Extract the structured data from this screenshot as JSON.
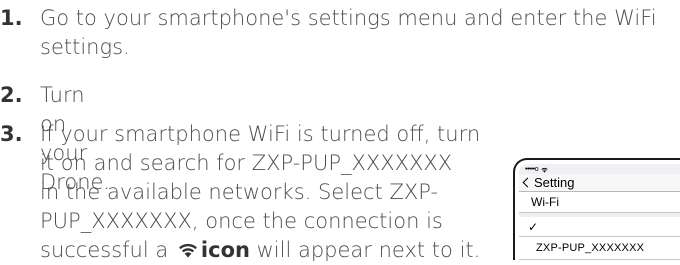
{
  "instructions": {
    "steps": [
      {
        "number": "1.",
        "text": "Go to your smartphone's settings menu and enter the WiFi\nsettings."
      },
      {
        "number": "2.",
        "text": "Turn on your Drone."
      },
      {
        "number": "3.",
        "text_before_icon": "If your smartphone WiFi is turned off, turn\nit on and search for ZXP-PUP_XXXXXXX\nin the available networks. Select ZXP-\nPUP_XXXXXXX, once the connection is\nsuccessful a",
        "icon_name": "wifi-icon",
        "icon_word": "icon",
        "text_after_icon": " will appear next to it."
      }
    ]
  },
  "phone": {
    "status_bar": {
      "signal": "•••••o",
      "wifi_icon": "wifi-icon"
    },
    "nav": {
      "back_label": "Setting"
    },
    "wifi_row_label": "Wi-Fi",
    "check_mark": "✓",
    "network_name": "ZXP-PUP_XXXXXXX"
  }
}
